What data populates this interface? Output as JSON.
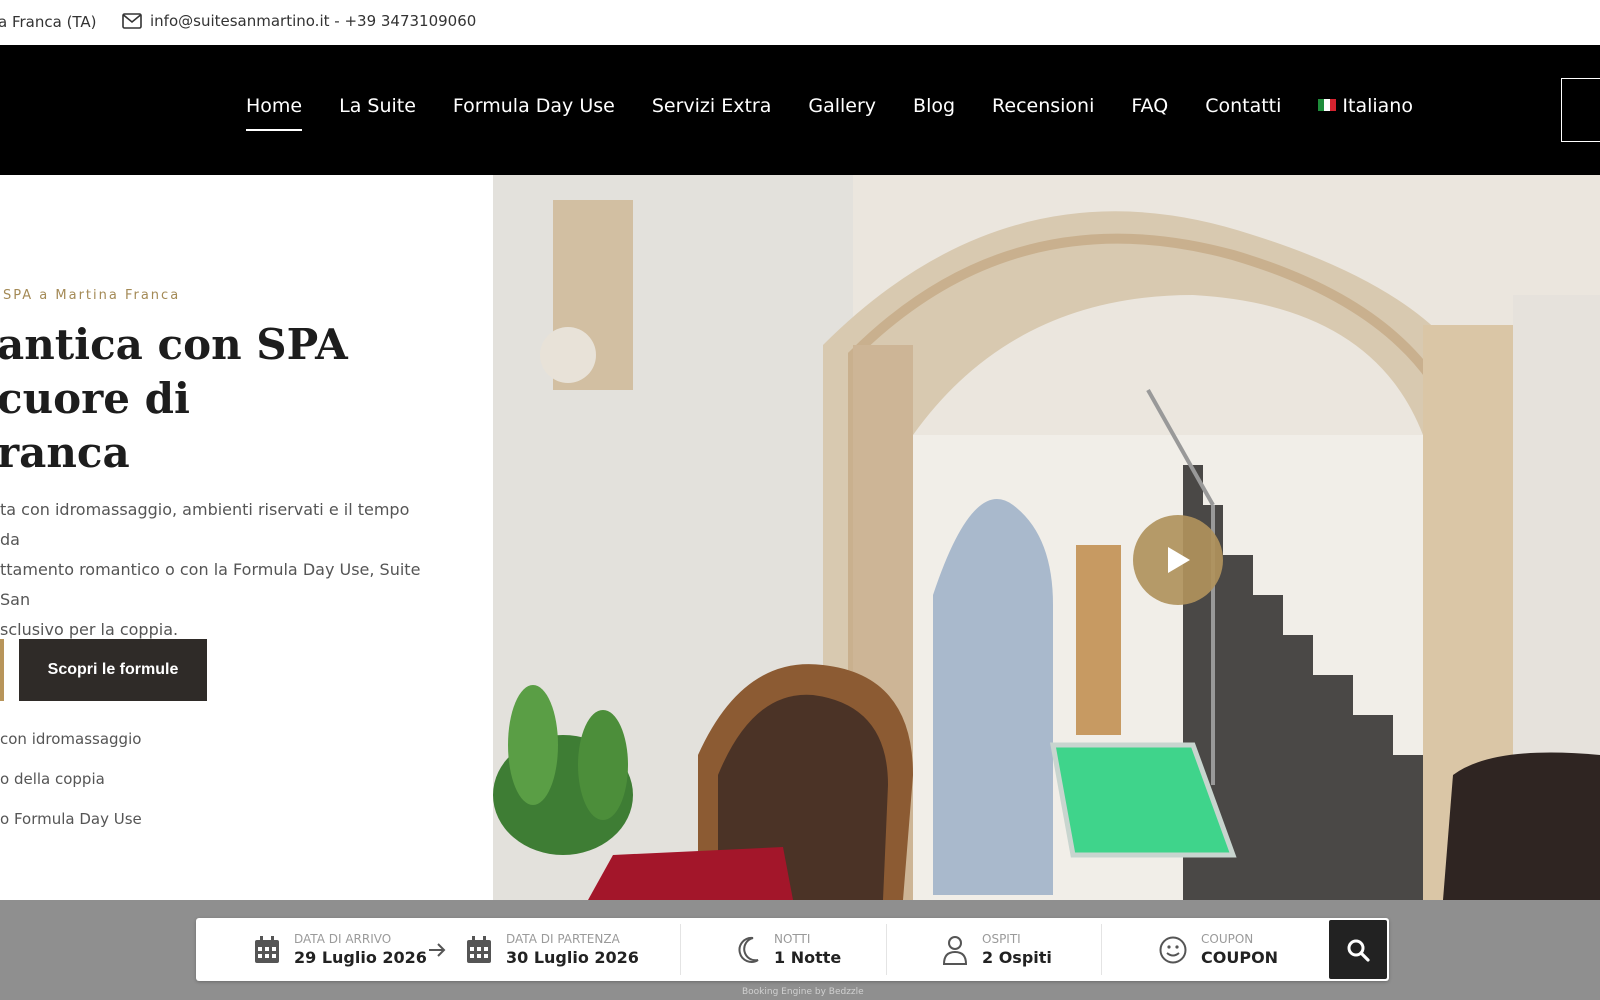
{
  "topbar": {
    "location": "a Franca (TA)",
    "contact": "info@suitesanmartino.it - +39 3473109060"
  },
  "nav": {
    "items": [
      "Home",
      "La Suite",
      "Formula Day Use",
      "Servizi Extra",
      "Gallery",
      "Blog",
      "Recensioni",
      "FAQ",
      "Contatti"
    ],
    "language": "Italiano",
    "active": "Home"
  },
  "hero": {
    "eyebrow": "SPA a Martina Franca",
    "title": "antica con SPA\n cuore di\nranca",
    "description": "ta con idromassaggio, ambienti riservati e il tempo da ttamento romantico o con la Formula Day Use, Suite San sclusivo per la coppia.",
    "desc_lines": [
      "ta con idromassaggio, ambienti riservati e il tempo da",
      "ttamento romantico o con la Formula Day Use, Suite San",
      "sclusivo per la coppia."
    ],
    "cta_label": "Scopri le formule",
    "features": [
      "con idromassaggio",
      "o della coppia",
      "o Formula Day Use"
    ]
  },
  "booking": {
    "arrival": {
      "label": "DATA DI ARRIVO",
      "value": "29 Luglio 2026"
    },
    "departure": {
      "label": "DATA DI PARTENZA",
      "value": "30 Luglio 2026"
    },
    "nights": {
      "label": "NOTTI",
      "value": "1 Notte"
    },
    "guests": {
      "label": "OSPITI",
      "value": "2 Ospiti"
    },
    "coupon": {
      "label": "COUPON",
      "value": "COUPON"
    },
    "powered_by": "Booking Engine by Bedzzle"
  },
  "colors": {
    "accent_gold": "#b8955a",
    "nav_bg": "#000000",
    "button_dark": "#2f2b28",
    "booking_bg": "#8f8f8f"
  },
  "icons": [
    "mail-icon",
    "italy-flag-icon",
    "play-icon",
    "calendar-icon",
    "arrow-right-icon",
    "moon-icon",
    "user-icon",
    "smiley-icon",
    "search-icon"
  ]
}
